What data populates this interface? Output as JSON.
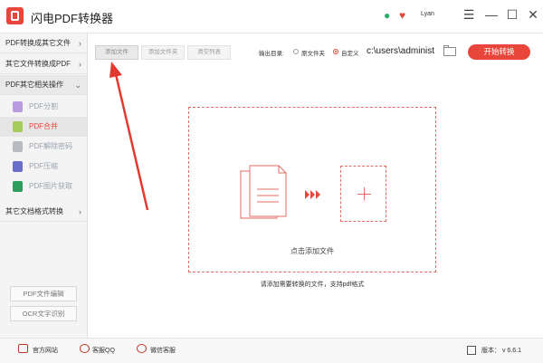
{
  "app": {
    "title": "闪电PDF转换器",
    "user": "Lyan"
  },
  "sidebar": {
    "categories": [
      {
        "label": "PDF转换成其它文件"
      },
      {
        "label": "其它文件转换成PDF"
      },
      {
        "label": "PDF其它相关操作"
      },
      {
        "label": "其它文档格式转换"
      }
    ],
    "items": [
      {
        "label": "PDF分割",
        "icon": "split-icon"
      },
      {
        "label": "PDF合并",
        "icon": "merge-icon"
      },
      {
        "label": "PDF解除密码",
        "icon": "unlock-icon"
      },
      {
        "label": "PDF压缩",
        "icon": "compress-icon"
      },
      {
        "label": "PDF图片获取",
        "icon": "image-extract-icon"
      }
    ],
    "bottom_buttons": [
      {
        "label": "PDF文件编辑"
      },
      {
        "label": "OCR文字识别"
      }
    ]
  },
  "toolbar": {
    "add_file": "添加文件",
    "add_folder": "添加文件夹",
    "clear_list": "清空列表",
    "output_label": "输出目录:",
    "option_source": "原文件夹",
    "option_custom": "自定义",
    "output_path": "c:\\users\\administ",
    "start_label": "开始转换"
  },
  "main": {
    "drop_text": "点击添加文件",
    "hint": "请添加需要转换的文件，支持pdf格式"
  },
  "status": {
    "website": "官方网站",
    "qq": "客服QQ",
    "wechat": "微信客服",
    "version": "版本： v 6.6.1"
  },
  "colors": {
    "accent": "#e8463b",
    "sidebar_bg": "#f4f4f4",
    "dashed": "#e06b62"
  }
}
